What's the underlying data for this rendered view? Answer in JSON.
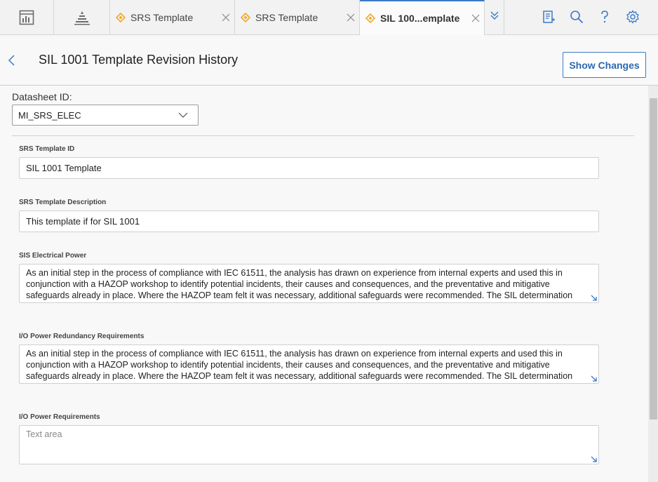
{
  "topbar": {
    "tabs": [
      {
        "label": "SRS Template",
        "active": false
      },
      {
        "label": "SRS Template",
        "active": false
      },
      {
        "label": "SIL 100...emplate",
        "active": true
      }
    ],
    "icons": [
      "dashboard-icon",
      "hierarchy-icon",
      "overflow-chevron-icon",
      "notes-icon",
      "search-icon",
      "help-icon",
      "settings-icon"
    ]
  },
  "header": {
    "title": "SIL 1001 Template Revision History",
    "show_changes_label": "Show Changes"
  },
  "datasheet": {
    "label": "Datasheet ID:",
    "value": "MI_SRS_ELEC"
  },
  "fields": {
    "template_id": {
      "label": "SRS Template ID",
      "value": "SIL 1001 Template"
    },
    "template_description": {
      "label": "SRS Template Description",
      "value": "This template if for SIL 1001"
    },
    "sis_power": {
      "label": "SIS Electrical Power",
      "value": "As an initial step in the process of compliance with IEC 61511, the analysis has drawn on experience from internal experts and used this in conjunction with a HAZOP workshop to identify potential incidents, their causes and consequences, and the preventative and mitigative safeguards already in place. Where the HAZOP team felt it was necessary, additional safeguards were recommended.  The SIL determination workshop used the results of the HAZOP to determine the safety integrity level of the safety functions."
    },
    "io_redundancy": {
      "label": "I/O Power Redundancy Requirements",
      "value": "As an initial step in the process of compliance with IEC 61511, the analysis has drawn on experience from internal experts and used this in conjunction with a HAZOP workshop to identify potential incidents, their causes and consequences, and the preventative and mitigative safeguards already in place. Where the HAZOP team felt it was necessary, additional safeguards were recommended.  The SIL determination workshop used the results of the HAZOP to determine the safety integrity level of the safety functions."
    },
    "io_power": {
      "label": "I/O Power Requirements",
      "placeholder": "Text area"
    }
  },
  "colors": {
    "accent": "#3a7ac9",
    "tab_diamond": "#f0a92c"
  }
}
